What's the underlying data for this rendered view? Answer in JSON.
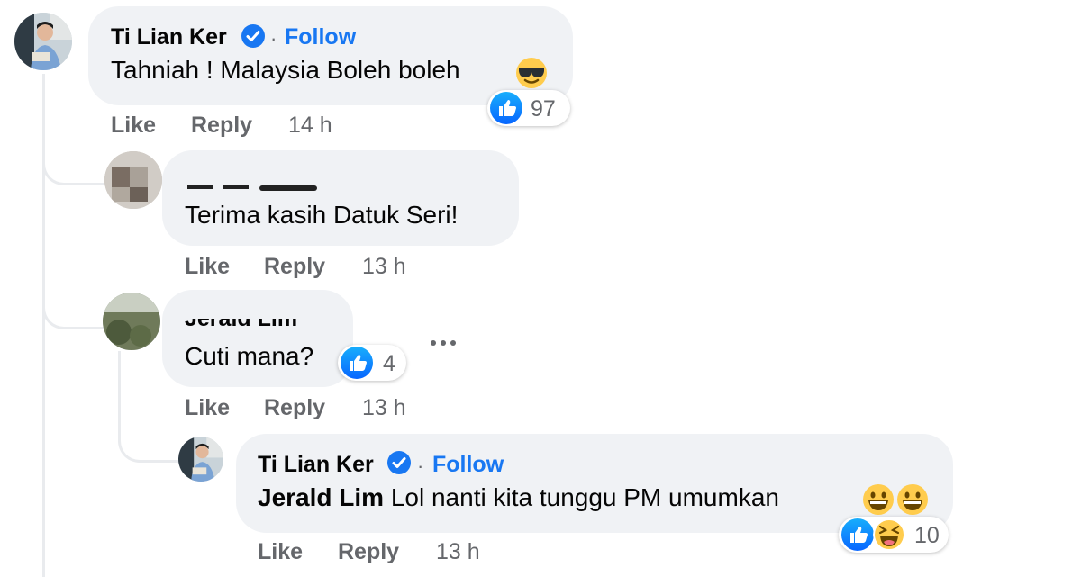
{
  "comments": [
    {
      "author": "Ti Lian Ker",
      "follow": "Follow",
      "text": "Tahniah ! Malaysia Boleh boleh",
      "emoji": [
        "smiling-face-with-sunglasses"
      ],
      "reaction_count": "97",
      "like": "Like",
      "reply": "Reply",
      "time": "14 h"
    },
    {
      "author": "",
      "text": "Terima kasih Datuk Seri!",
      "like": "Like",
      "reply": "Reply",
      "time": "13 h"
    },
    {
      "author": "Jerald Lim",
      "text": "Cuti mana?",
      "reaction_count": "4",
      "like": "Like",
      "reply": "Reply",
      "time": "13 h"
    },
    {
      "author": "Ti Lian Ker",
      "follow": "Follow",
      "mention": "Jerald Lim",
      "text": "Lol nanti kita tunggu PM umumkan",
      "emoji": [
        "grinning-face",
        "grinning-face"
      ],
      "reaction_count": "10",
      "like": "Like",
      "reply": "Reply",
      "time": "13 h"
    }
  ],
  "separator": "·",
  "colors": {
    "link": "#1877f2",
    "meta": "#65676b",
    "bubble": "#f0f2f5"
  }
}
